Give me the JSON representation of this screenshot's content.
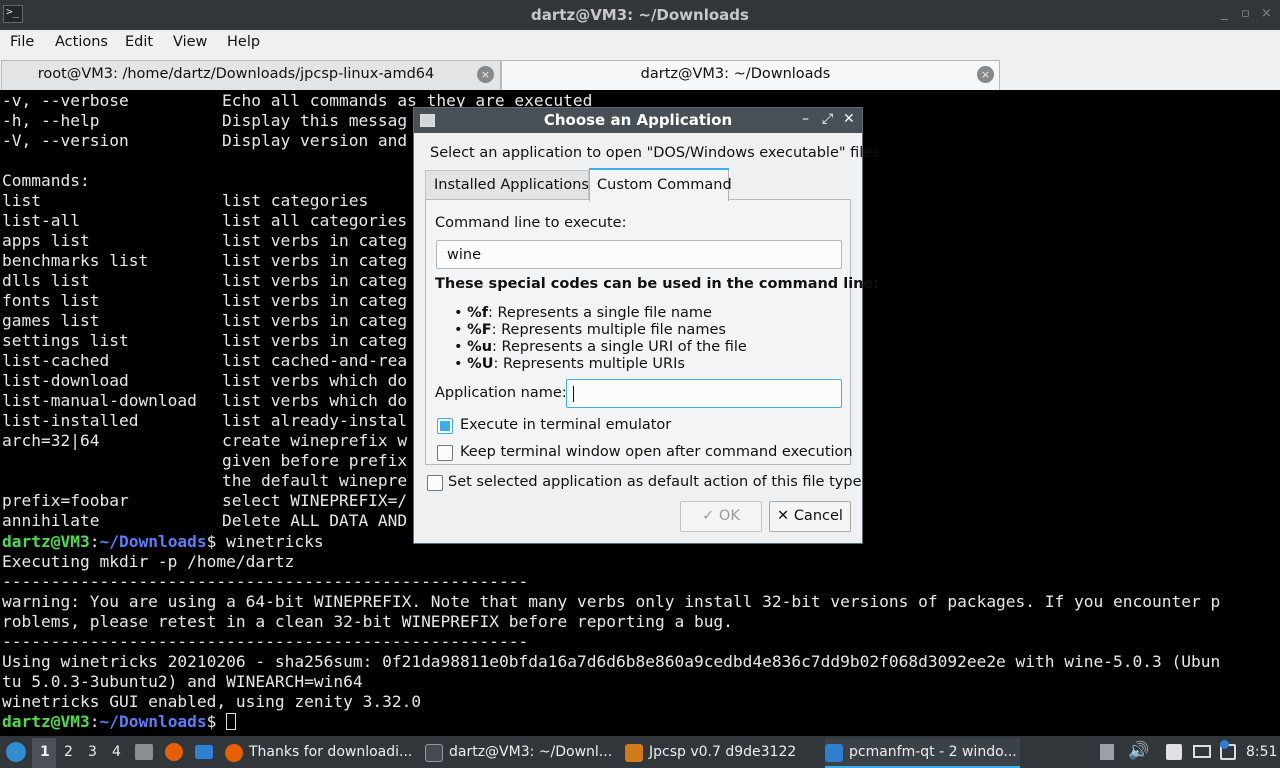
{
  "window": {
    "title": "dartz@VM3: ~/Downloads",
    "controls": [
      "_",
      "▫",
      "×"
    ]
  },
  "menu": [
    "File",
    "Actions",
    "Edit",
    "View",
    "Help"
  ],
  "tabs": [
    {
      "label": "root@VM3: /home/dartz/Downloads/jpcsp-linux-amd64",
      "close": "×"
    },
    {
      "label": "dartz@VM3: ~/Downloads",
      "close": "×"
    }
  ],
  "terminal": {
    "two_col": [
      [
        "-v, --verbose",
        "Echo all commands as they are executed"
      ],
      [
        "-h, --help",
        "Display this messag"
      ],
      [
        "-V, --version",
        "Display version and"
      ],
      [
        "",
        ""
      ],
      [
        "Commands:",
        ""
      ],
      [
        "list",
        "list categories"
      ],
      [
        "list-all",
        "list all categories"
      ],
      [
        "apps list",
        "list verbs in categ"
      ],
      [
        "benchmarks list",
        "list verbs in categ"
      ],
      [
        "dlls list",
        "list verbs in categ"
      ],
      [
        "fonts list",
        "list verbs in categ"
      ],
      [
        "games list",
        "list verbs in categ"
      ],
      [
        "settings list",
        "list verbs in categ"
      ],
      [
        "list-cached",
        "list cached-and-rea"
      ],
      [
        "list-download",
        "list verbs which do"
      ],
      [
        "list-manual-download",
        "list verbs which do"
      ],
      [
        "list-installed",
        "list already-instal"
      ],
      [
        "arch=32|64",
        "create wineprefix w"
      ],
      [
        "",
        "given before prefix"
      ],
      [
        "",
        "the default winepre"
      ],
      [
        "prefix=foobar",
        "select WINEPREFIX=/"
      ],
      [
        "annihilate",
        "Delete ALL DATA AND"
      ]
    ],
    "prompt_user": "dartz@VM3",
    "prompt_sep": ":",
    "prompt_path": "~/Downloads",
    "prompt_end": "$ ",
    "command": "winetricks",
    "output": [
      "Executing mkdir -p /home/dartz",
      "------------------------------------------------------",
      "warning: You are using a 64-bit WINEPREFIX. Note that many verbs only install 32-bit versions of packages. If you encounter p",
      "roblems, please retest in a clean 32-bit WINEPREFIX before reporting a bug.",
      "------------------------------------------------------",
      "Using winetricks 20210206 - sha256sum: 0f21da98811e0bfda16a7d6d6b8e860a9cedbd4e836c7dd9b02f068d3092ee2e with wine-5.0.3 (Ubun",
      "tu 5.0.3-3ubuntu2) and WINEARCH=win64",
      "winetricks GUI enabled, using zenity 3.32.0"
    ]
  },
  "dialog": {
    "title": "Choose an Application",
    "controls": [
      "–",
      "⤢",
      "✕"
    ],
    "prompt": "Select an application to open \"DOS/Windows executable\" files",
    "tabs": [
      "Installed Applications",
      "Custom Command"
    ],
    "command_label": "Command line to execute:",
    "command_value": "wine",
    "codes_heading": "These special codes can be used in the command line:",
    "codes": [
      {
        "code": "%f",
        "desc": ": Represents a single file name"
      },
      {
        "code": "%F",
        "desc": ": Represents multiple file names"
      },
      {
        "code": "%u",
        "desc": ": Represents a single URI of the file"
      },
      {
        "code": "%U",
        "desc": ": Represents multiple URIs"
      }
    ],
    "app_name_label": "Application name:",
    "app_name_value": "",
    "exec_terminal_label": "Execute in terminal emulator",
    "exec_terminal_checked": true,
    "keep_open_label": "Keep terminal window open after command execution",
    "keep_open_checked": false,
    "set_default_label": "Set selected application as default action of this file type",
    "set_default_checked": false,
    "ok_label": "OK",
    "cancel_label": "Cancel"
  },
  "taskbar": {
    "desktops": [
      "1",
      "2",
      "3",
      "4"
    ],
    "tasks": [
      {
        "label": "Thanks for downloadi...",
        "color": "#e66000"
      },
      {
        "label": "dartz@VM3: ~/Downl...",
        "color": "#444a50"
      },
      {
        "label": "Jpcsp v0.7 d9de3122",
        "color": "#d07a1a"
      },
      {
        "label": "pcmanfm-qt - 2 windo...",
        "color": "#2e7fd0"
      }
    ],
    "clock": "8:51"
  }
}
